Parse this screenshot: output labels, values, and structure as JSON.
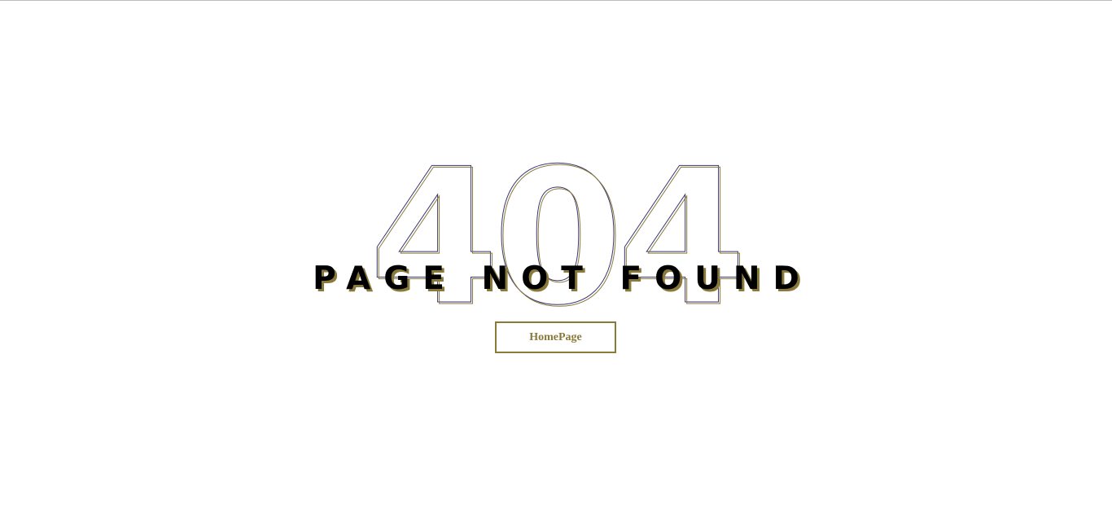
{
  "error_page": {
    "code": "404",
    "headline": "PAGE NOT FOUND",
    "home_button_label": "HomePage"
  },
  "colors": {
    "background": "#ffffff",
    "headline_text": "#000000",
    "accent_gold": "#8a7a3a",
    "outline_navy": "#3a3470"
  }
}
